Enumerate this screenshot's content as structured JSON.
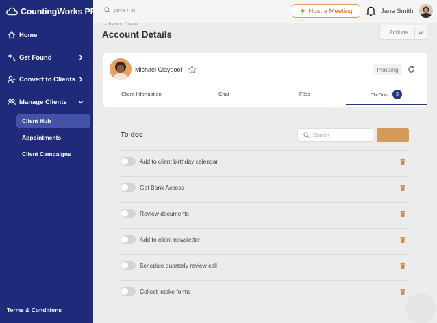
{
  "app": {
    "name": "CountingWorks PRO"
  },
  "sidebar": {
    "items": [
      {
        "label": "Home",
        "icon": "home-icon"
      },
      {
        "label": "Get Found",
        "icon": "sparkle-icon"
      },
      {
        "label": "Convert to Clients",
        "icon": "user-plus-icon"
      },
      {
        "label": "Manage Clients",
        "icon": "users-icon"
      }
    ],
    "sub_items": [
      {
        "label": "Client Hub",
        "active": true
      },
      {
        "label": "Appointments"
      },
      {
        "label": "Client Campaigns"
      }
    ],
    "footer": "Terms & Conditions"
  },
  "topbar": {
    "search_text": "jonsi + s)",
    "host_button": "Host a Meeting",
    "user_name": "Jane Smith"
  },
  "header": {
    "back_link": "← Back to Clients",
    "title": "Account Details",
    "actions": "Actions"
  },
  "client": {
    "name": "Michael Claypool",
    "status": "Pending",
    "tabs": [
      "Client Information",
      "Chat",
      "Files",
      "To-Dos"
    ],
    "todos_count": "3"
  },
  "todos": {
    "title": "To-dos",
    "search_placeholder": "Search",
    "items": [
      {
        "label": "Add to client birthday calendar"
      },
      {
        "label": "Get Bank Access"
      },
      {
        "label": "Review documents"
      },
      {
        "label": "Add to client newsletter"
      },
      {
        "label": "Schedule quarterly review call"
      },
      {
        "label": "Collect intake forms"
      }
    ]
  },
  "colors": {
    "sidebar": "#1f2a7a",
    "active_item": "#4352a8",
    "accent": "#d59a5a",
    "host_border": "#e09b5a"
  }
}
